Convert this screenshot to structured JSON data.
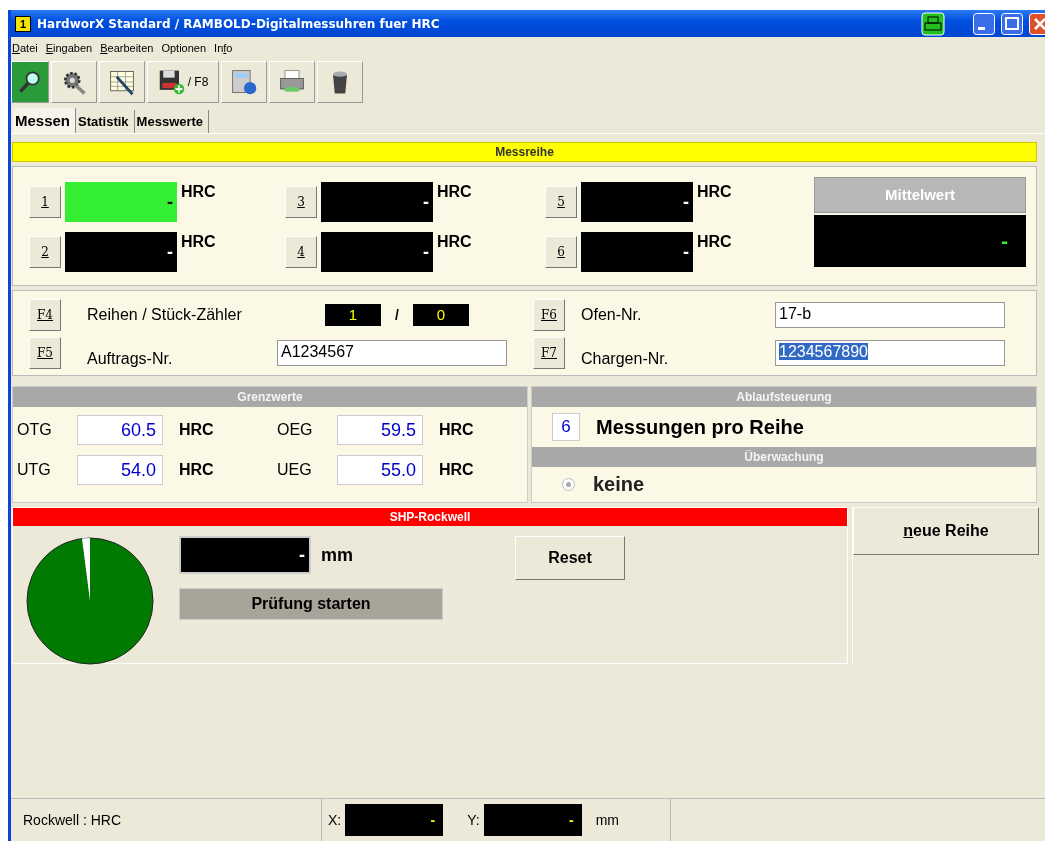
{
  "window": {
    "title": "HardworX Standard / RAMBOLD-Digitalmessuhren fuer HRC",
    "app_badge": "1"
  },
  "menu": [
    {
      "key": "D",
      "post": "atei"
    },
    {
      "key": "E",
      "post": "ingaben"
    },
    {
      "key": "B",
      "post": "earbeiten"
    },
    {
      "pre": "Optionen"
    },
    {
      "pre": "In",
      "key": "f",
      "post": "o"
    }
  ],
  "toolbar": {
    "save_shortcut": "/ F8"
  },
  "tabs": [
    {
      "label": "Messen",
      "selected": true
    },
    {
      "label": "Statistik",
      "selected": false
    },
    {
      "label": "Messwerte",
      "selected": false
    }
  ],
  "messreihe": {
    "title": "Messreihe",
    "measurements": [
      {
        "key": "1",
        "value": "-",
        "unit": "HRC",
        "active": true
      },
      {
        "key": "2",
        "value": "-",
        "unit": "HRC",
        "active": false
      },
      {
        "key": "3",
        "value": "-",
        "unit": "HRC",
        "active": false
      },
      {
        "key": "4",
        "value": "-",
        "unit": "HRC",
        "active": false
      },
      {
        "key": "5",
        "value": "-",
        "unit": "HRC",
        "active": false
      },
      {
        "key": "6",
        "value": "-",
        "unit": "HRC",
        "active": false
      }
    ],
    "mean": {
      "label": "Mittelwert",
      "value": "-"
    }
  },
  "counter": {
    "key": "F4",
    "label": "Reihen / Stück-Zähler",
    "series": "1",
    "separator": "/",
    "pieces": "0"
  },
  "order": {
    "key": "F5",
    "label": "Auftrags-Nr.",
    "value": "A1234567",
    "selected": false
  },
  "furnace": {
    "key": "F6",
    "label": "Ofen-Nr.",
    "value": "17-b",
    "selected": false
  },
  "batch": {
    "key": "F7",
    "label": "Chargen-Nr.",
    "value": "1234567890",
    "selected": true
  },
  "limits": {
    "title": "Grenzwerte",
    "items": [
      {
        "label": "OTG",
        "value": "60.5",
        "unit": "HRC"
      },
      {
        "label": "OEG",
        "value": "59.5",
        "unit": "HRC"
      },
      {
        "label": "UTG",
        "value": "54.0",
        "unit": "HRC"
      },
      {
        "label": "UEG",
        "value": "55.0",
        "unit": "HRC"
      }
    ]
  },
  "sequence": {
    "title": "Ablaufsteuerung",
    "count": "6",
    "label": "Messungen pro Reihe"
  },
  "monitoring": {
    "title": "Überwachung",
    "options": [
      {
        "label": "keine",
        "selected": true,
        "disabled": true
      }
    ]
  },
  "rockwell": {
    "title": "SHP-Rockwell",
    "depth": "-",
    "unit": "mm",
    "reset": "Reset",
    "start": "Prüfung starten"
  },
  "new_series": {
    "key": "n",
    "post": "eue Reihe"
  },
  "status_bar": {
    "mode": "Rockwell : HRC",
    "x_label": "X:",
    "x_value": "-",
    "y_label": "Y:",
    "y_value": "-",
    "unit": "mm"
  }
}
